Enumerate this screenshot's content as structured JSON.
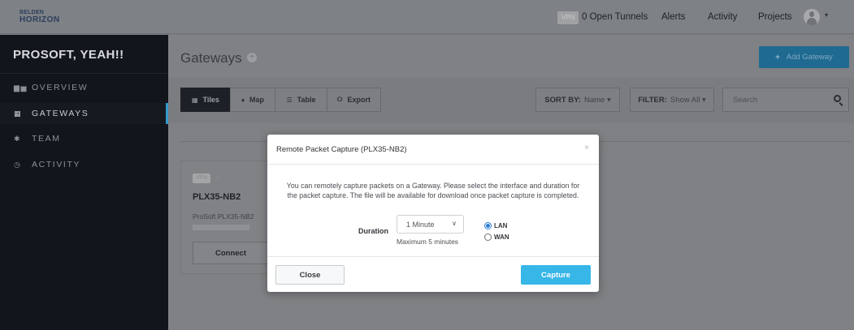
{
  "header": {
    "logo_line1": "BELDEN",
    "logo_line2": "HORIZON",
    "vpn_badge": "VPN",
    "open_tunnels": "0 Open Tunnels",
    "nav": {
      "alerts": "Alerts",
      "activity": "Activity",
      "projects": "Projects"
    },
    "avatar_caret": "▾"
  },
  "sidebar": {
    "org_name": "PROSOFT, YEAH!!",
    "items": [
      {
        "label": "OVERVIEW",
        "icon": "bar-chart-icon",
        "glyph": "▆▅"
      },
      {
        "label": "GATEWAYS",
        "icon": "grid-icon",
        "glyph": "▦"
      },
      {
        "label": "TEAM",
        "icon": "users-icon",
        "glyph": "✱"
      },
      {
        "label": "ACTIVITY",
        "icon": "clock-icon",
        "glyph": "◷"
      }
    ],
    "active": "GATEWAYS"
  },
  "main": {
    "title": "Gateways",
    "add_button": "Add Gateway",
    "views": [
      {
        "label": "Tiles",
        "glyph": "▦"
      },
      {
        "label": "Map",
        "glyph": "♦"
      },
      {
        "label": "Table",
        "glyph": "☰"
      },
      {
        "label": "Export",
        "glyph": "⭘"
      }
    ],
    "sort": {
      "label": "SORT BY:",
      "value": "Name ▾"
    },
    "filter": {
      "label": "FILTER:",
      "value": "Show All ▾"
    },
    "search": {
      "placeholder": "Search"
    }
  },
  "gateway_card": {
    "badge": "VPN",
    "name": "PLX35-NB2",
    "model": "ProSoft PLX35-NB2",
    "connect_label": "Connect"
  },
  "modal": {
    "title": "Remote Packet Capture (PLX35-NB2)",
    "close_x": "×",
    "description": "You can remotely capture packets on a Gateway. Please select the interface and duration for the packet capture. The file will be available for download once packet capture is completed.",
    "duration_label": "Duration",
    "duration_value": "1 Minute",
    "duration_hint": "Maximum 5 minutes",
    "interfaces": [
      {
        "label": "LAN",
        "selected": true
      },
      {
        "label": "WAN",
        "selected": false
      }
    ],
    "close_button": "Close",
    "capture_button": "Capture"
  },
  "colors": {
    "accent": "#37b6e8",
    "sidebar_bg": "#12161c",
    "active_indicator": "#3399cc"
  }
}
